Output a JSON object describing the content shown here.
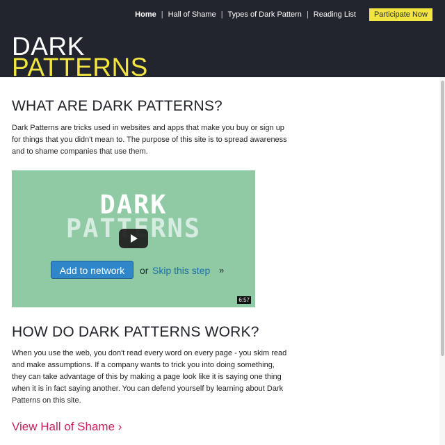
{
  "nav": {
    "items": [
      "Home",
      "Hall of Shame",
      "Types of Dark Pattern",
      "Reading List"
    ],
    "separator": "|",
    "cta_label": "Participate Now"
  },
  "logo": {
    "line1": "DARK",
    "line2": "PATTERNS"
  },
  "section_what": {
    "heading": "WHAT ARE DARK PATTERNS?",
    "body": "Dark Patterns are tricks used in websites and apps that make you buy or sign up for things that you didn't mean to. The purpose of this site is to spread awareness and to shame companies that use them."
  },
  "video": {
    "title_line1": "DARK",
    "title_line2": "PATTERNS",
    "add_button": "Add to network",
    "or_text": "or",
    "skip_link": "Skip this step",
    "skip_arrow": "»",
    "duration": "6:57",
    "play_icon": "play-icon"
  },
  "section_how": {
    "heading": "HOW DO DARK PATTERNS WORK?",
    "body": "When you use the web, you don't read every word on every page - you skim read and make assumptions. If a company wants to trick you into doing something, they can take advantage of this by making a page look like it is saying one thing when it is in fact saying another. You can defend yourself by learning about Dark Patterns on this site."
  },
  "link": {
    "view_hall": "View Hall of Shame ›"
  },
  "colors": {
    "header_bg": "#22252d",
    "accent_yellow": "#f2e542",
    "video_bg": "#8fcaa4",
    "link_pink": "#c8215e"
  }
}
